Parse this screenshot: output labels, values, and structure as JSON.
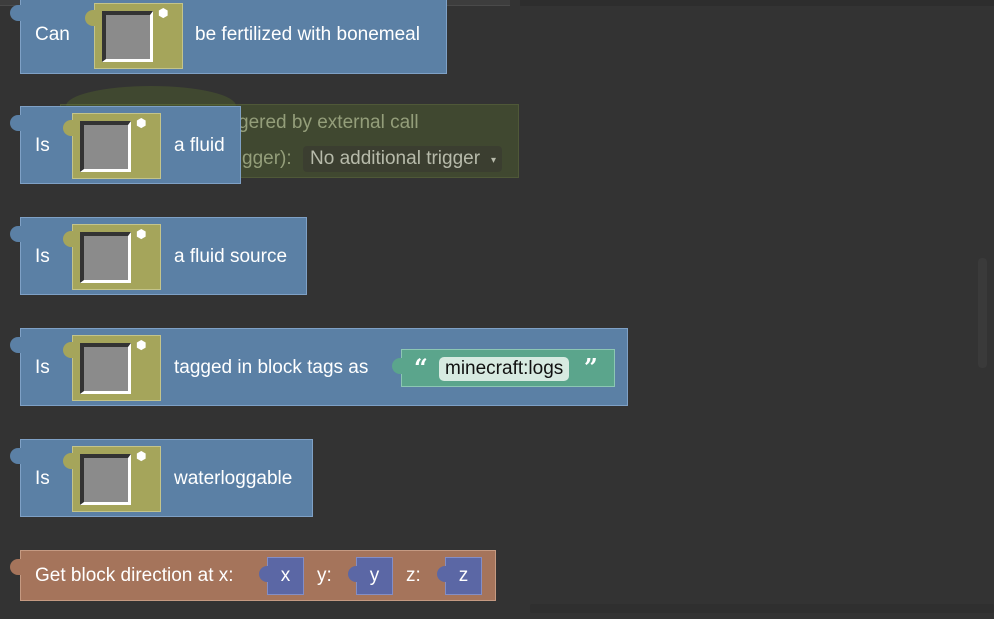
{
  "workspace": {
    "background_color": "#333333"
  },
  "ghost_event": {
    "line1": "gered by external call",
    "line2": "gger):",
    "dropdown_value": "No additional trigger",
    "dropdown_arrow": "▾",
    "color": "#4b5a2e"
  },
  "blocks": [
    {
      "label_before": "Can",
      "label_after": "be fertilized with bonemeal",
      "color": "#5b80a5"
    },
    {
      "label_before": "Is",
      "label_after": "a fluid",
      "color": "#5b80a5"
    },
    {
      "label_before": "Is",
      "label_after": "a fluid source",
      "color": "#5b80a5"
    },
    {
      "label_before": "Is",
      "label_after": "tagged in block tags as",
      "color": "#5b80a5"
    },
    {
      "label_before": "Is",
      "label_after": "waterloggable",
      "color": "#5b80a5"
    }
  ],
  "tag_string": {
    "open_quote": "“",
    "value": "minecraft:logs",
    "close_quote": "”",
    "color": "#5ba58c"
  },
  "itemslot": {
    "icon": "cube-icon",
    "icon_glyph": "⬢",
    "color": "#a5a55b"
  },
  "direction_block": {
    "label": "Get block direction at x:",
    "y_label": "y:",
    "z_label": "z:",
    "x_var": "x",
    "y_var": "y",
    "z_var": "z",
    "color": "#a5745b",
    "var_color": "#5b67a5"
  }
}
